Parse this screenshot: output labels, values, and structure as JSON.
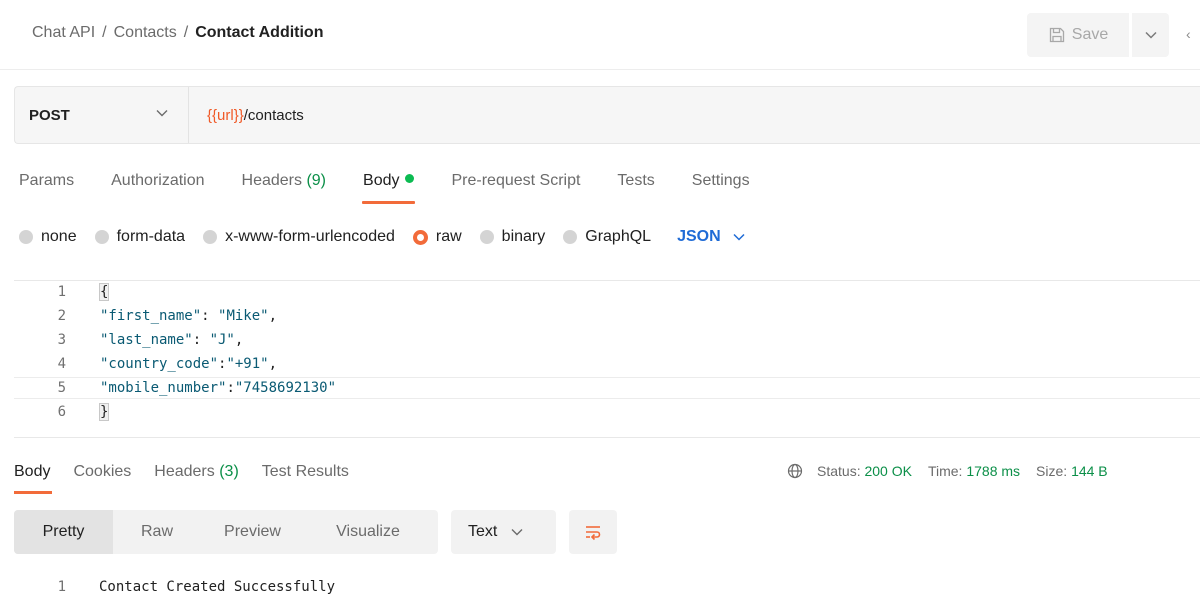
{
  "breadcrumb": {
    "parts": [
      "Chat API",
      "Contacts"
    ],
    "current": "Contact Addition",
    "separator": "/"
  },
  "toolbar": {
    "save_label": "Save"
  },
  "request": {
    "method": "POST",
    "url_variable": "{{url}}",
    "url_path": "/contacts"
  },
  "request_tabs": [
    {
      "label": "Params"
    },
    {
      "label": "Authorization"
    },
    {
      "label": "Headers",
      "count": "(9)"
    },
    {
      "label": "Body",
      "active": true
    },
    {
      "label": "Pre-request Script"
    },
    {
      "label": "Tests"
    },
    {
      "label": "Settings"
    }
  ],
  "body_options": {
    "none": "none",
    "form_data": "form-data",
    "urlencoded": "x-www-form-urlencoded",
    "raw": "raw",
    "binary": "binary",
    "graphql": "GraphQL",
    "selected": "raw",
    "format": "JSON"
  },
  "editor": {
    "line_numbers": [
      "1",
      "2",
      "3",
      "4",
      "5",
      "6"
    ],
    "open_brace": "{",
    "close_brace": "}",
    "lines": [
      {
        "key": "\"first_name\"",
        "sep": ": ",
        "value": "\"Mike\"",
        "end": ","
      },
      {
        "key": "\"last_name\"",
        "sep": ": ",
        "value": "\"J\"",
        "end": ","
      },
      {
        "key": "\"country_code\"",
        "sep": ":",
        "value": "\"+91\"",
        "end": ","
      },
      {
        "key": "\"mobile_number\"",
        "sep": ":",
        "value": "\"7458692130\"",
        "end": ""
      }
    ]
  },
  "response_tabs": [
    {
      "label": "Body",
      "active": true
    },
    {
      "label": "Cookies"
    },
    {
      "label": "Headers",
      "count": "(3)"
    },
    {
      "label": "Test Results"
    }
  ],
  "status": {
    "status_label": "Status:",
    "status_value": "200 OK",
    "time_label": "Time:",
    "time_value": "1788 ms",
    "size_label": "Size:",
    "size_value": "144 B"
  },
  "response_view": {
    "pretty": "Pretty",
    "raw": "Raw",
    "preview": "Preview",
    "visualize": "Visualize",
    "format": "Text"
  },
  "response_body": {
    "line_number": "1",
    "text": "Contact Created Successfully"
  },
  "colors": {
    "accent": "#f26b3a",
    "url_variable": "#f05a28",
    "success": "#0b8f48",
    "link_blue": "#1f6bd6"
  }
}
